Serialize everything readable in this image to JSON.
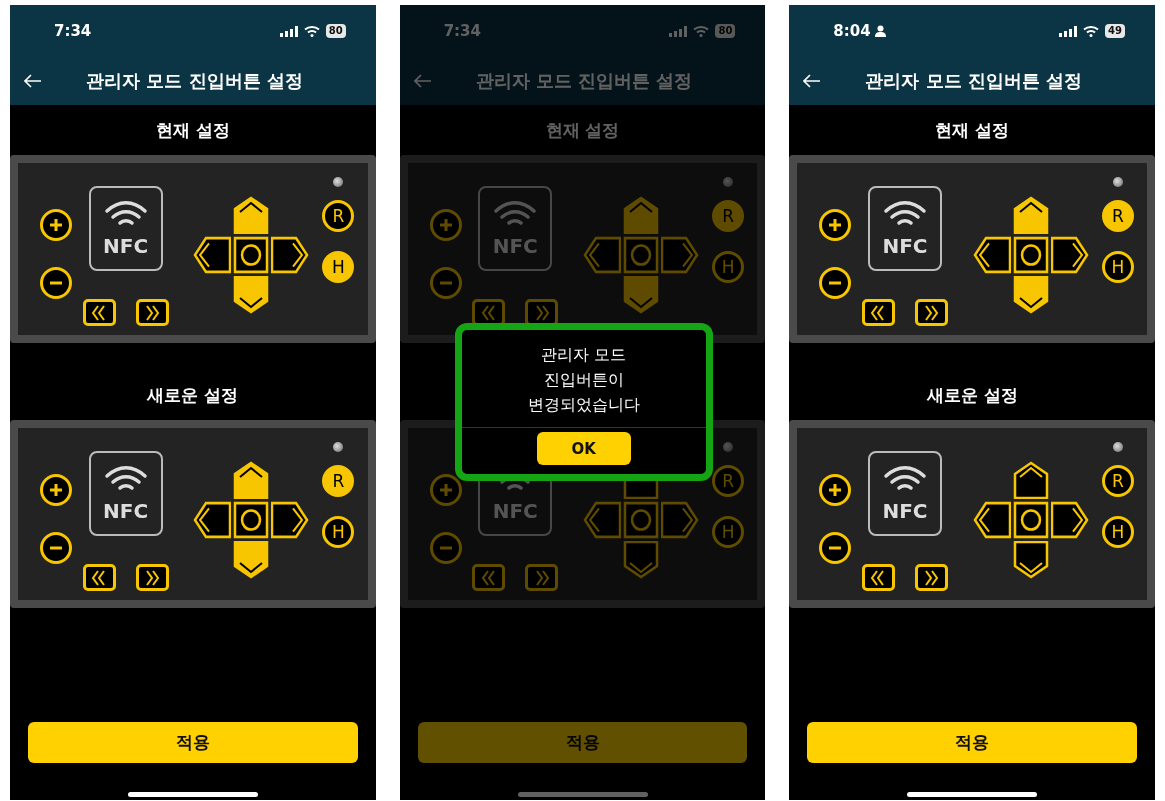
{
  "phones": [
    {
      "status_bar": {
        "time": "7:34",
        "user_icon": false,
        "battery": "80"
      },
      "header": {
        "title": "관리자 모드 진입버튼 설정"
      },
      "sections": [
        {
          "label": "현재 설정",
          "keys": [
            {
              "kind": "plus",
              "selected": false
            },
            {
              "kind": "minus",
              "selected": false
            },
            {
              "kind": "nfc",
              "label": "NFC",
              "selected": false
            },
            {
              "kind": "rewind",
              "selected": false
            },
            {
              "kind": "forward",
              "selected": false
            },
            {
              "kind": "up",
              "selected": true
            },
            {
              "kind": "left",
              "selected": false
            },
            {
              "kind": "center",
              "selected": false
            },
            {
              "kind": "right",
              "selected": false
            },
            {
              "kind": "down",
              "selected": true
            },
            {
              "kind": "letter",
              "label": "R",
              "selected": false
            },
            {
              "kind": "letter",
              "label": "H",
              "selected": true
            }
          ]
        },
        {
          "label": "새로운 설정",
          "keys": [
            {
              "kind": "plus",
              "selected": false
            },
            {
              "kind": "minus",
              "selected": false
            },
            {
              "kind": "nfc",
              "label": "NFC",
              "selected": false
            },
            {
              "kind": "rewind",
              "selected": false
            },
            {
              "kind": "forward",
              "selected": false
            },
            {
              "kind": "up",
              "selected": true
            },
            {
              "kind": "left",
              "selected": false
            },
            {
              "kind": "center",
              "selected": false
            },
            {
              "kind": "right",
              "selected": false
            },
            {
              "kind": "down",
              "selected": true
            },
            {
              "kind": "letter",
              "label": "R",
              "selected": true
            },
            {
              "kind": "letter",
              "label": "H",
              "selected": false
            }
          ]
        }
      ],
      "apply_button": "적용"
    },
    {
      "status_bar": {
        "time": "7:34",
        "user_icon": false,
        "battery": "80"
      },
      "header": {
        "title": "관리자 모드 진입버튼 설정"
      },
      "sections": [
        {
          "label": "현재 설정",
          "keys": [
            {
              "kind": "plus",
              "selected": false
            },
            {
              "kind": "minus",
              "selected": false
            },
            {
              "kind": "nfc",
              "label": "NFC",
              "selected": false
            },
            {
              "kind": "rewind",
              "selected": false
            },
            {
              "kind": "forward",
              "selected": false
            },
            {
              "kind": "up",
              "selected": true
            },
            {
              "kind": "left",
              "selected": false
            },
            {
              "kind": "center",
              "selected": false
            },
            {
              "kind": "right",
              "selected": false
            },
            {
              "kind": "down",
              "selected": true
            },
            {
              "kind": "letter",
              "label": "R",
              "selected": true
            },
            {
              "kind": "letter",
              "label": "H",
              "selected": false
            }
          ]
        },
        {
          "keys": [
            {
              "kind": "plus",
              "selected": false
            },
            {
              "kind": "minus",
              "selected": false
            },
            {
              "kind": "nfc",
              "label": "NFC",
              "selected": false
            },
            {
              "kind": "rewind",
              "selected": false
            },
            {
              "kind": "forward",
              "selected": false
            },
            {
              "kind": "up",
              "selected": false
            },
            {
              "kind": "left",
              "selected": false
            },
            {
              "kind": "center",
              "selected": false
            },
            {
              "kind": "right",
              "selected": false
            },
            {
              "kind": "down",
              "selected": false
            },
            {
              "kind": "letter",
              "label": "R",
              "selected": false
            },
            {
              "kind": "letter",
              "label": "H",
              "selected": false
            }
          ]
        }
      ],
      "apply_button": "적용",
      "dialog": {
        "message": "관리자 모드\n진입버튼이\n변경되었습니다",
        "ok_button": "OK"
      }
    },
    {
      "status_bar": {
        "time": "8:04",
        "user_icon": true,
        "battery": "49"
      },
      "header": {
        "title": "관리자 모드 진입버튼 설정"
      },
      "sections": [
        {
          "label": "현재 설정",
          "keys": [
            {
              "kind": "plus",
              "selected": false
            },
            {
              "kind": "minus",
              "selected": false
            },
            {
              "kind": "nfc",
              "label": "NFC",
              "selected": false
            },
            {
              "kind": "rewind",
              "selected": false
            },
            {
              "kind": "forward",
              "selected": false
            },
            {
              "kind": "up",
              "selected": true
            },
            {
              "kind": "left",
              "selected": false
            },
            {
              "kind": "center",
              "selected": false
            },
            {
              "kind": "right",
              "selected": false
            },
            {
              "kind": "down",
              "selected": true
            },
            {
              "kind": "letter",
              "label": "R",
              "selected": true
            },
            {
              "kind": "letter",
              "label": "H",
              "selected": false
            }
          ]
        },
        {
          "label": "새로운 설정",
          "keys": [
            {
              "kind": "plus",
              "selected": false
            },
            {
              "kind": "minus",
              "selected": false
            },
            {
              "kind": "nfc",
              "label": "NFC",
              "selected": false
            },
            {
              "kind": "rewind",
              "selected": false
            },
            {
              "kind": "forward",
              "selected": false
            },
            {
              "kind": "up",
              "selected": false
            },
            {
              "kind": "left",
              "selected": false
            },
            {
              "kind": "center",
              "selected": false
            },
            {
              "kind": "right",
              "selected": false
            },
            {
              "kind": "down",
              "selected": false
            },
            {
              "kind": "letter",
              "label": "R",
              "selected": false
            },
            {
              "kind": "letter",
              "label": "H",
              "selected": false
            }
          ]
        }
      ],
      "apply_button": "적용"
    }
  ]
}
